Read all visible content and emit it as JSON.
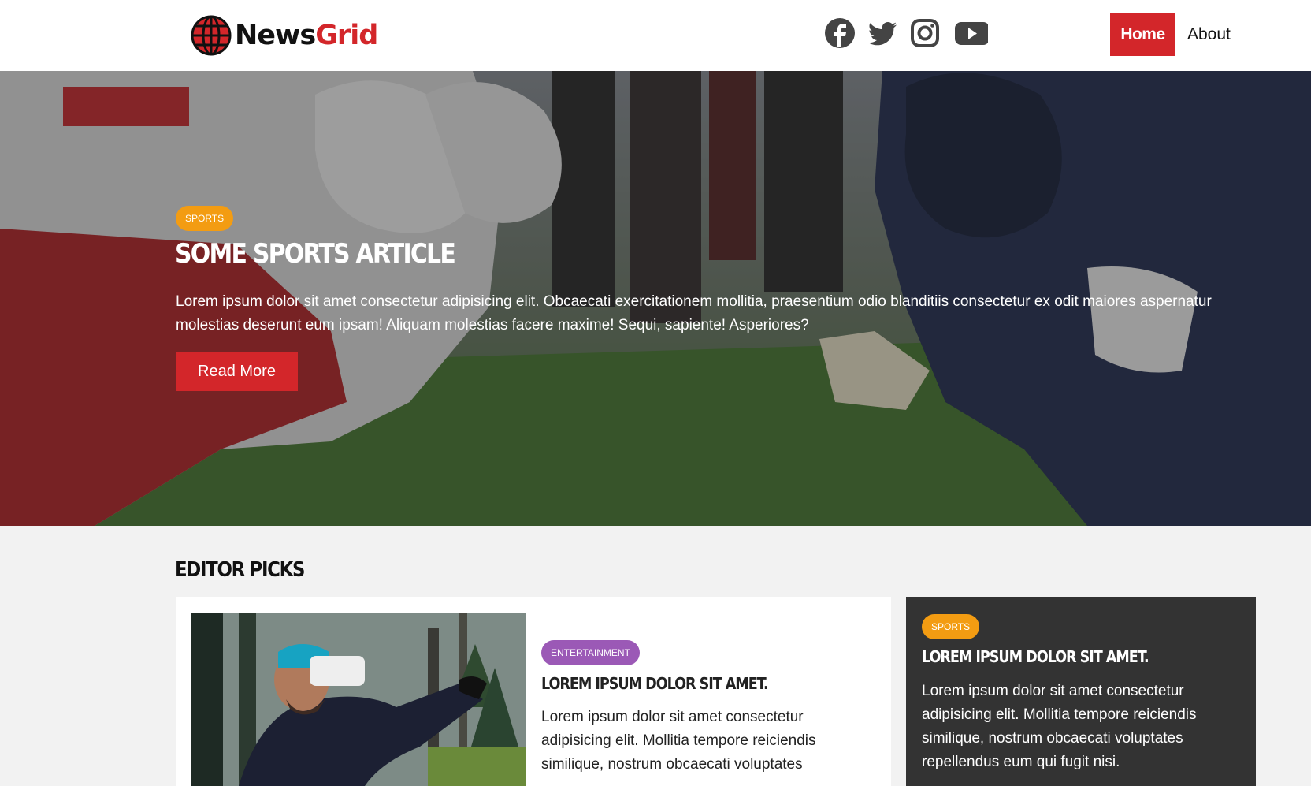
{
  "header": {
    "logo": {
      "part1": "News",
      "part2": "Grid"
    },
    "social": [
      "facebook-icon",
      "twitter-icon",
      "instagram-icon",
      "youtube-icon"
    ],
    "nav": {
      "home": "Home",
      "about": "About"
    }
  },
  "hero": {
    "category": "SPORTS",
    "title": "Some Sports Article",
    "text": "Lorem ipsum dolor sit amet consectetur adipisicing elit. Obcaecati exercitationem mollitia, praesentium odio blanditiis consectetur ex odit maiores aspernatur molestias deserunt eum ipsam! Aliquam molestias facere maxime! Sequi, sapiente! Asperiores?",
    "button": "Read More"
  },
  "editor_picks": {
    "title": "Editor Picks",
    "main_card": {
      "category": "ENTERTAINMENT",
      "title": "Lorem ipsum dolor sit amet.",
      "text": "Lorem ipsum dolor sit amet consectetur adipisicing elit. Mollitia tempore reiciendis similique, nostrum obcaecati voluptates"
    },
    "side_card": {
      "category": "SPORTS",
      "title": "Lorem ipsum dolor sit amet.",
      "text": "Lorem ipsum dolor sit amet consectetur adipisicing elit. Mollitia tempore reiciendis similique, nostrum obcaecati voluptates repellendus eum qui fugit nisi."
    }
  },
  "colors": {
    "accent": "#d3262a",
    "sports": "#f39c12",
    "entertainment": "#9b59b6",
    "dark_card": "#333333"
  }
}
